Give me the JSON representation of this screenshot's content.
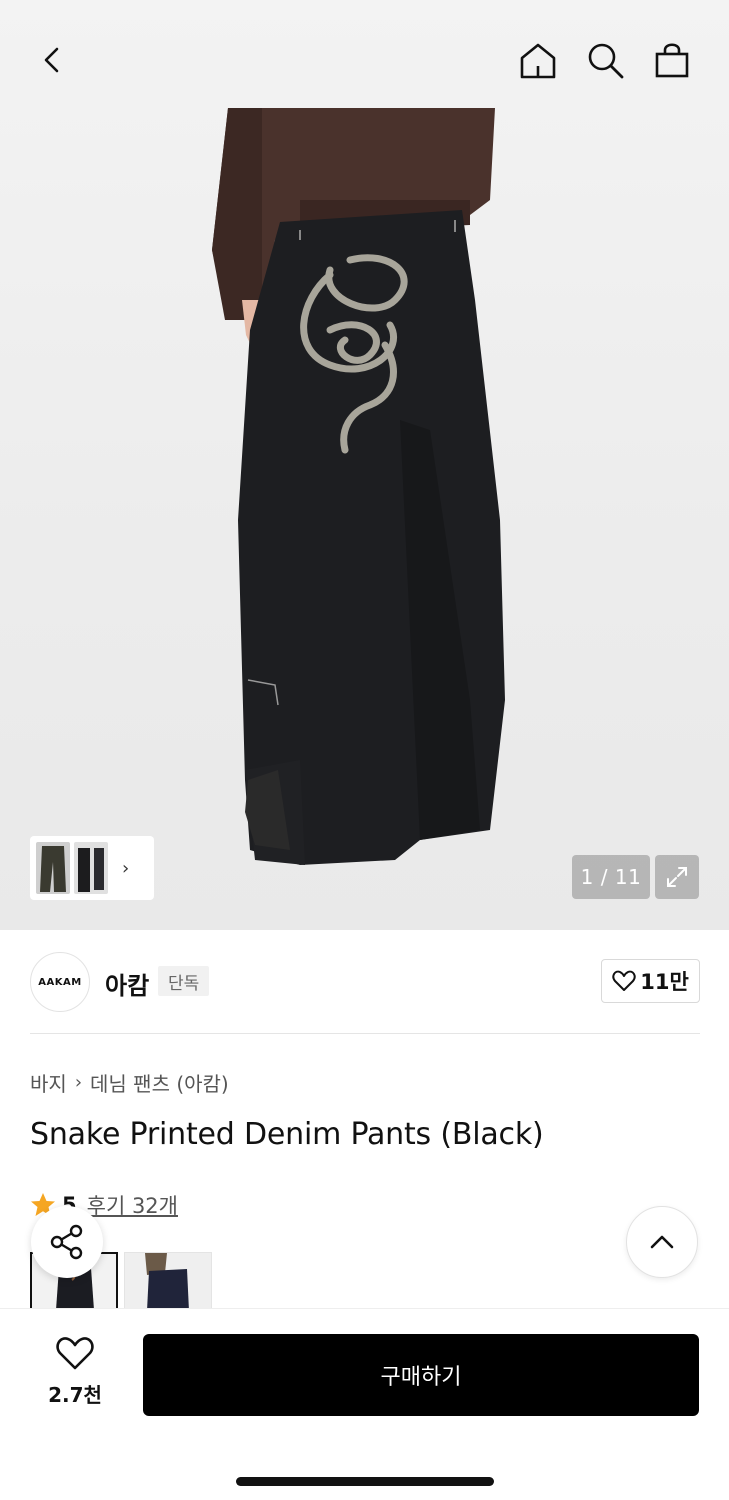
{
  "header": {
    "back_icon": "chevron-left-icon",
    "home_icon": "home-icon",
    "search_icon": "search-icon",
    "bag_icon": "shopping-bag-icon"
  },
  "gallery": {
    "counter": "1 / 11",
    "expand_icon": "expand-icon",
    "thumb_arrow": "›"
  },
  "brand": {
    "logo_text": "AAKAM",
    "name": "아캄",
    "badge": "단독",
    "likes": "11만"
  },
  "breadcrumb": {
    "category": "바지",
    "separator": "›",
    "subcategory": "데님 팬츠 (아캄)"
  },
  "product": {
    "title": "Snake Printed Denim Pants (Black)",
    "rating": "5",
    "reviews": "후기 32개"
  },
  "bottom": {
    "wish_count": "2.7천",
    "buy_label": "구매하기"
  },
  "colors": {
    "accent_star": "#f5a623",
    "buy_button": "#000000"
  }
}
